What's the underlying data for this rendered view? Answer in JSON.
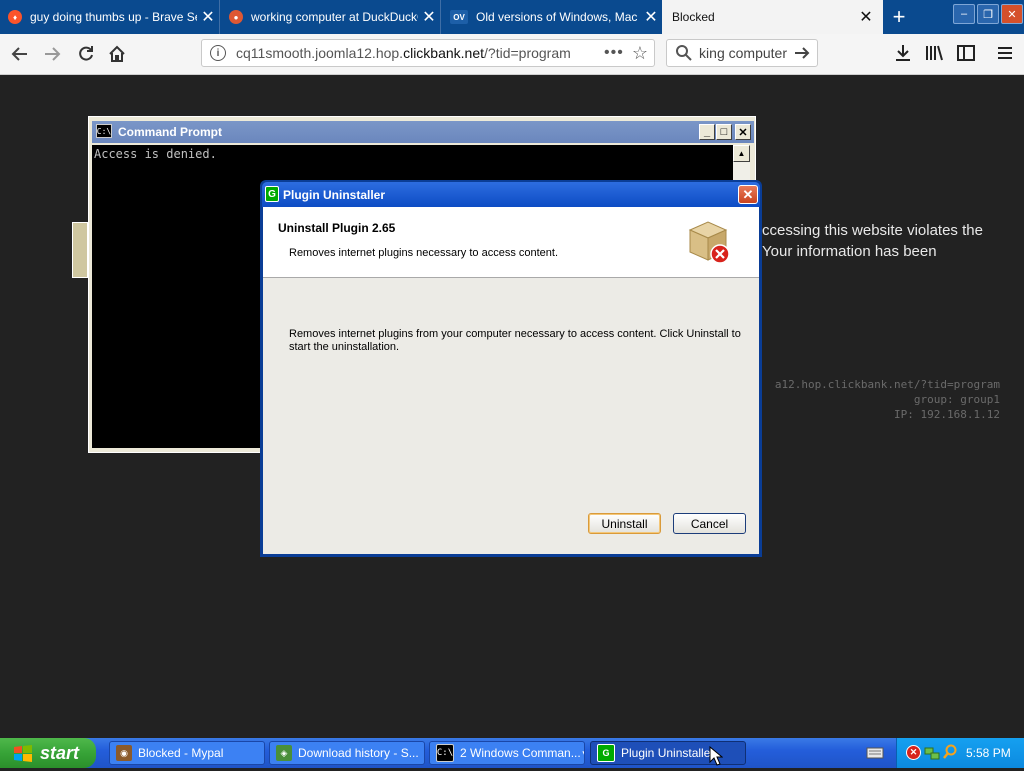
{
  "browser": {
    "tabs": [
      {
        "label": "guy doing thumbs up - Brave Search",
        "active": false
      },
      {
        "label": "working computer at DuckDuckGo",
        "active": false
      },
      {
        "label": "Old versions of Windows, Mac and",
        "favicon_text": "OV",
        "active": false
      },
      {
        "label": "Blocked",
        "active": true
      }
    ],
    "tab_close": "✕",
    "new_tab": "+",
    "window_controls": {
      "minimize": "‒",
      "restore": "❐",
      "close": "✕"
    },
    "url": {
      "host_prefix": "cq11smooth.joomla12.hop.",
      "host_domain": "clickbank.net",
      "path": "/?tid=program"
    },
    "search_value": "working computer",
    "page_actions": "•••"
  },
  "blocked_page": {
    "line1": "ccessing this website violates the",
    "line2": "Your information has been",
    "meta_url": "a12.hop.clickbank.net/?tid=program",
    "meta_group": "group: group1",
    "meta_ip": "IP: 192.168.1.12"
  },
  "cmd_window": {
    "title": "Command Prompt",
    "icon_text": "C:\\",
    "output": "Access is denied."
  },
  "dialog": {
    "title": "Plugin Uninstaller",
    "icon_letter": "G",
    "heading": "Uninstall Plugin 2.65",
    "subheading": "Removes internet plugins necessary to access content.",
    "body_line1": "Removes internet plugins from your computer necessary to access content.  Click Uninstall to",
    "body_line2": "start the uninstallation.",
    "buttons": {
      "uninstall": "Uninstall",
      "cancel": "Cancel"
    }
  },
  "taskbar": {
    "start": "start",
    "tasks": [
      {
        "label": "Blocked - Mypal"
      },
      {
        "label": "Download history - S..."
      },
      {
        "label": "2 Windows Comman..."
      },
      {
        "label": "Plugin Uninstaller",
        "active": true
      }
    ],
    "clock": "5:58 PM"
  }
}
